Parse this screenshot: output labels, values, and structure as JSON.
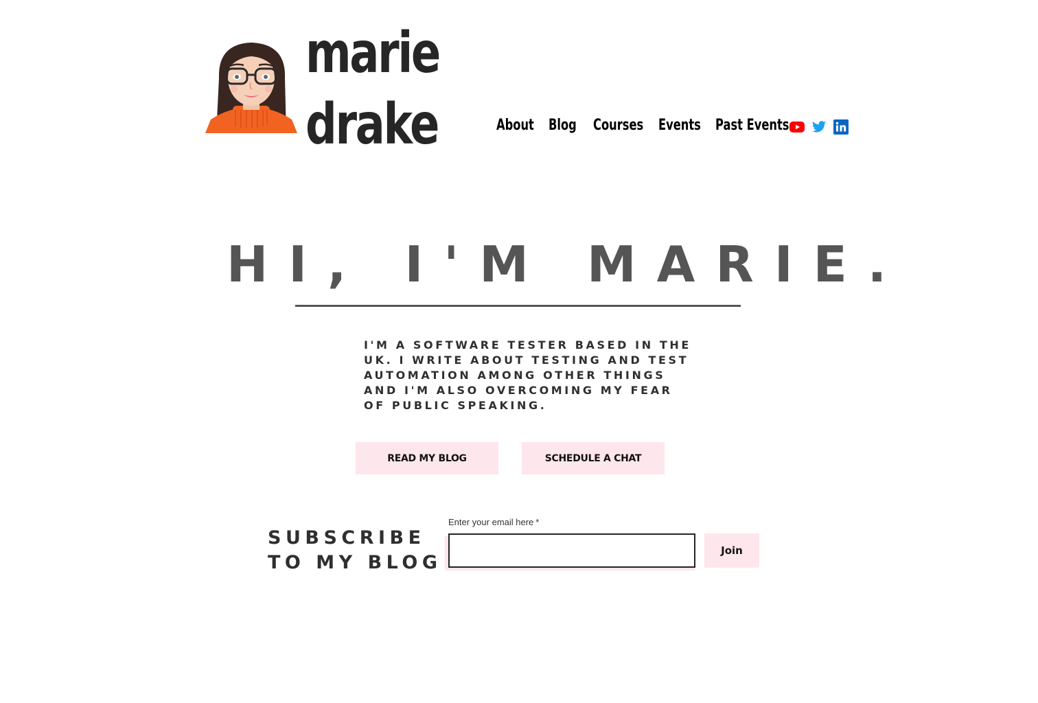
{
  "header": {
    "brand_line1": "marie",
    "brand_line2": "drake",
    "nav": [
      "About",
      "Blog",
      "Courses",
      "Events",
      "Past Events"
    ],
    "social": [
      "youtube-icon",
      "twitter-icon",
      "linkedin-icon"
    ]
  },
  "hero": {
    "title": "HI, I'M MARIE.",
    "intro": "I'm a software tester based in the UK. I write about testing and test automation among other things and I'm also overcoming my fear of public speaking.",
    "buttons": {
      "read_blog": "READ MY BLOG",
      "schedule_chat": "SCHEDULE A CHAT"
    }
  },
  "subscribe": {
    "title_line1": "SUBSCRIBE",
    "title_line2": "TO MY BLOG",
    "email_label": "Enter your email here",
    "required_mark": "*",
    "email_value": "",
    "join_label": "Join"
  },
  "colors": {
    "button_bg": "#fde6ec",
    "heading_gray": "#555555",
    "youtube_red": "#ff0000",
    "twitter_blue": "#1da1f2",
    "linkedin_blue": "#0a66c2"
  }
}
